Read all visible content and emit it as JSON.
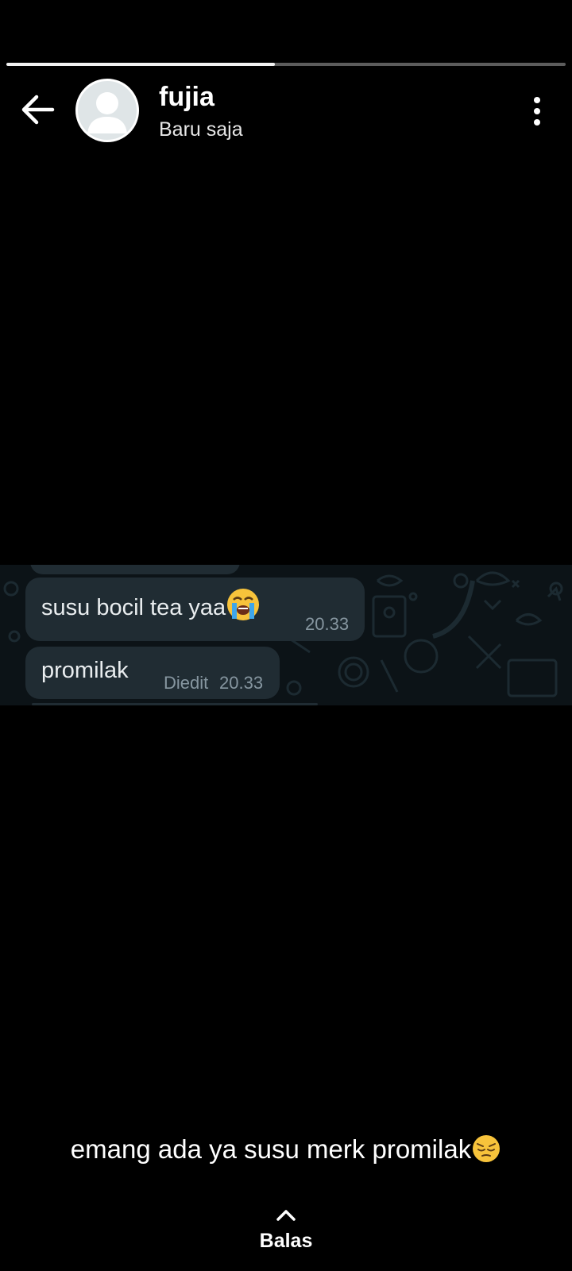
{
  "status": {
    "progress": 0.48
  },
  "header": {
    "contact_name": "fujia",
    "contact_status": "Baru saja"
  },
  "chat_screenshot": {
    "messages": [
      {
        "text": "susu bocil tea yaa",
        "emoji": "loudly-crying-face",
        "time": "20.33",
        "edited_label": ""
      },
      {
        "text": "promilak",
        "emoji": "",
        "time": "20.33",
        "edited_label": "Diedit"
      }
    ]
  },
  "caption": {
    "text": "emang ada ya susu merk promilak",
    "emoji": "pensive-face"
  },
  "reply": {
    "label": "Balas",
    "icon": "chevron-up-icon"
  },
  "colors": {
    "background": "#000000",
    "bubble": "#202c33",
    "chat_wallpaper": "#0c1317",
    "timestamp": "#8696a0"
  }
}
